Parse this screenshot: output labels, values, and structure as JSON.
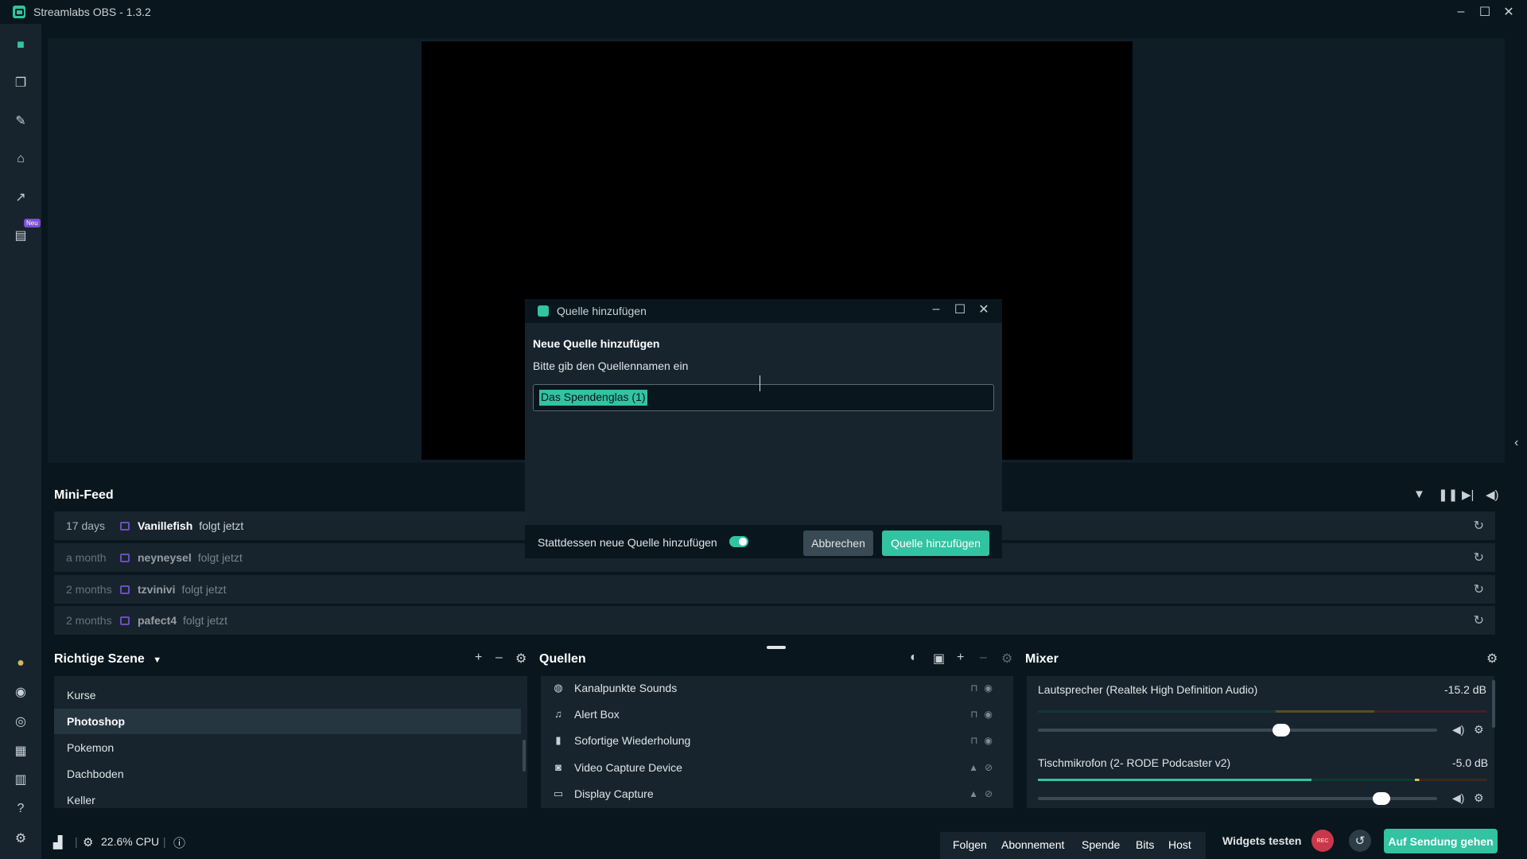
{
  "window": {
    "title": "Streamlabs OBS - 1.3.2",
    "accent": "#31c3a2"
  },
  "nav": {
    "icons": [
      "camera-icon",
      "themes-icon",
      "editor-tools-icon",
      "store-icon",
      "stats-icon",
      "highlighter-icon"
    ],
    "new_badge": "Neu"
  },
  "minifeed": {
    "title": "Mini-Feed",
    "items": [
      {
        "time": "17 days",
        "user": "Vanillefish",
        "action": "folgt jetzt"
      },
      {
        "time": "a month",
        "user": "neyneysel",
        "action": "folgt jetzt"
      },
      {
        "time": "2 months",
        "user": "tzvinivi",
        "action": "folgt jetzt"
      },
      {
        "time": "2 months",
        "user": "pafect4",
        "action": "folgt jetzt"
      }
    ]
  },
  "scenes": {
    "title": "Richtige Szene",
    "items": [
      "Kurse",
      "Photoshop",
      "Pokemon",
      "Dachboden",
      "Keller"
    ],
    "selected": "Photoshop"
  },
  "sources": {
    "title": "Quellen",
    "items": [
      {
        "name": "Kanalpunkte Sounds",
        "icon": "globe-icon"
      },
      {
        "name": "Alert Box",
        "icon": "bell-icon"
      },
      {
        "name": "Sofortige Wiederholung",
        "icon": "file-icon"
      },
      {
        "name": "Video Capture Device",
        "icon": "webcam-icon"
      },
      {
        "name": "Display Capture",
        "icon": "monitor-icon"
      }
    ]
  },
  "mixer": {
    "title": "Mixer",
    "channels": [
      {
        "name": "Lautsprecher (Realtek High Definition Audio)",
        "db": "-15.2 dB",
        "level": 0.61
      },
      {
        "name": "Tischmikrofon (2- RODE Podcaster v2)",
        "db": "-5.0 dB",
        "level": 0.86
      }
    ]
  },
  "footer": {
    "cpu": "22.6% CPU",
    "alert_tabs": [
      "Folgen",
      "Abonnement",
      "Spende",
      "Bits",
      "Host"
    ],
    "widgets_test": "Widgets testen",
    "rec": "REC",
    "go_live": "Auf Sendung gehen"
  },
  "modal": {
    "title": "Quelle hinzufügen",
    "heading": "Neue Quelle hinzufügen",
    "prompt": "Bitte gib den Quellennamen ein",
    "input_value": "Das Spendenglas (1)",
    "toggle_label": "Stattdessen neue Quelle hinzufügen",
    "toggle_on": true,
    "cancel": "Abbrechen",
    "add": "Quelle hinzufügen"
  }
}
